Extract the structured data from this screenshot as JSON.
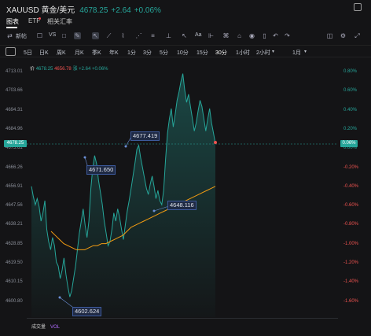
{
  "title": {
    "symbol": "XAUUSD 黄金/美元",
    "price": "4678.25",
    "change": "+2.64",
    "change_pct": "+0.06%"
  },
  "tabs": [
    {
      "label": "图表",
      "active": true
    },
    {
      "label": "ETF",
      "badge": true
    },
    {
      "label": "相关汇率"
    }
  ],
  "toolbar": {
    "items": [
      "新帖",
      "VS",
      "Aa"
    ],
    "icons": [
      "indicator-icon",
      "checkbox-icon",
      "compare-icon",
      "pen-icon",
      "cursor-icon",
      "line-icon",
      "trend-icon",
      "channel-icon",
      "fib-icon",
      "arrow-icon",
      "text-icon",
      "measure-icon",
      "lock-icon",
      "eye-icon",
      "delete-icon",
      "undo-icon",
      "redo-icon",
      "camera-icon",
      "settings-icon",
      "fullscreen-icon"
    ]
  },
  "timeframes": [
    "5日",
    "日K",
    "周K",
    "月K",
    "季K",
    "年K",
    "1分",
    "3分",
    "5分",
    "10分",
    "15分",
    "30分",
    "1小时",
    "2小时",
    "1月"
  ],
  "active_timeframe": "30分",
  "legend": {
    "label": "价",
    "ma1": "4678.25",
    "ma2": "4656.78",
    "ma3": "涨 +2.64",
    "ma4": "+0.06%"
  },
  "current_price_left": "4678.25",
  "current_price_right": "0.06%",
  "y_axis_left": [
    "4713.01",
    "4703.66",
    "4694.31",
    "4684.96",
    "4675.61",
    "4666.26",
    "4656.91",
    "4647.56",
    "4638.21",
    "4628.85",
    "4619.50",
    "4610.15",
    "4600.80"
  ],
  "y_axis_right": [
    "0.80%",
    "0.60%",
    "0.40%",
    "0.20%",
    "0.00%",
    "-0.20%",
    "-0.40%",
    "-0.60%",
    "-0.80%",
    "-1.00%",
    "-1.20%",
    "-1.40%",
    "-1.60%"
  ],
  "annotations": [
    "4671.650",
    "4677.419",
    "4648.116",
    "4602.624"
  ],
  "volume": {
    "label": "成交量",
    "sub": "VOL"
  },
  "colors": {
    "up": "#26a69a",
    "down": "#ef5350",
    "ma": "#f39c12",
    "background": "#141416"
  },
  "chart_data": {
    "type": "line",
    "y_range": [
      4600.8,
      4713.01
    ],
    "price_series": [
      4657,
      4652,
      4648,
      4651,
      4647,
      4640,
      4644,
      4650,
      4636,
      4630,
      4626,
      4632,
      4628,
      4620,
      4618,
      4612,
      4616,
      4622,
      4614,
      4608,
      4603,
      4606,
      4612,
      4618,
      4626,
      4634,
      4640,
      4646,
      4638,
      4632,
      4640,
      4656,
      4666,
      4672,
      4668,
      4660,
      4654,
      4648,
      4640,
      4634,
      4628,
      4630,
      4636,
      4644,
      4640,
      4646,
      4642,
      4636,
      4631,
      4638,
      4645,
      4650,
      4656,
      4662,
      4668,
      4675,
      4677,
      4671,
      4666,
      4661,
      4656,
      4653,
      4658,
      4662,
      4657,
      4651,
      4655,
      4650,
      4648,
      4655,
      4670,
      4683,
      4690,
      4695,
      4686,
      4692,
      4699,
      4703,
      4708,
      4712,
      4704,
      4698,
      4702,
      4696,
      4690,
      4684,
      4688,
      4694,
      4699,
      4696,
      4690,
      4684,
      4690,
      4695,
      4688,
      4683,
      4678
    ],
    "ma_series": [
      4635,
      4633,
      4631,
      4629,
      4628,
      4627,
      4626,
      4626,
      4626,
      4627,
      4628,
      4628,
      4629,
      4629,
      4630,
      4631,
      4632,
      4633,
      4635,
      4637,
      4638,
      4639,
      4640,
      4641,
      4642,
      4643,
      4644,
      4645,
      4646,
      4647,
      4648,
      4649,
      4650,
      4651,
      4652,
      4653,
      4654,
      4655,
      4656,
      4657
    ],
    "annotations": [
      {
        "label": "4671.650",
        "value": 4671.65
      },
      {
        "label": "4677.419",
        "value": 4677.419
      },
      {
        "label": "4648.116",
        "value": 4648.116
      },
      {
        "label": "4602.624",
        "value": 4602.624
      }
    ]
  }
}
